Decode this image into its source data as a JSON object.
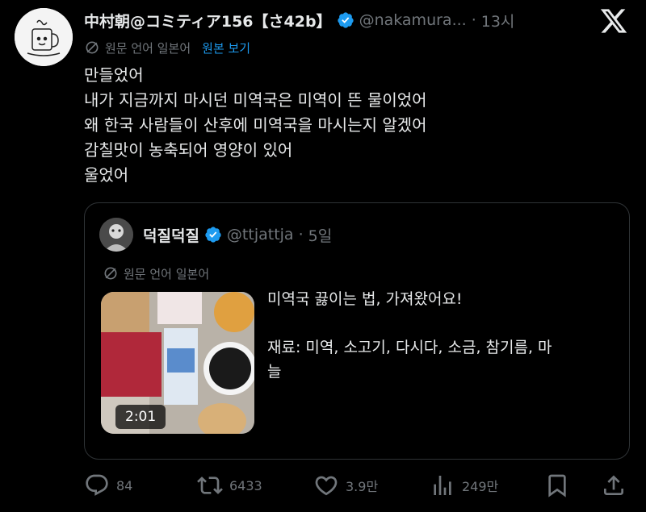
{
  "tweet": {
    "author_name": "中村朝@コミティア156【さ42b】",
    "author_handle": "@nakamura...",
    "time": "13시",
    "translation_note": "원문 언어 일본어",
    "show_original": "원본 보기",
    "text_lines": [
      "만들었어",
      "내가 지금까지 마시던 미역국은 미역이 뜬 물이었어",
      "왜 한국 사람들이 산후에 미역국을 마시는지 알겠어",
      "감칠맛이 농축되어 영양이 있어",
      "울었어"
    ]
  },
  "quote": {
    "author_name": "덕질덕질",
    "author_handle": "@ttjattja",
    "time": "5일",
    "translation_note": "원문 언어 일본어",
    "video_duration": "2:01",
    "text_lines": [
      "미역국 끓이는 법, 가져왔어요!",
      "",
      "재료: 미역, 소고기, 다시다, 소금, 참기름, 마",
      "늘"
    ]
  },
  "actions": {
    "replies": "84",
    "retweets": "6433",
    "likes": "3.9만",
    "views": "249만"
  },
  "colors": {
    "background": "#000000",
    "text": "#e7e9ea",
    "secondary": "#71767b",
    "accent": "#1d9bf0",
    "border": "#2f3336"
  },
  "icons": [
    "x-logo-icon",
    "verified-badge-icon",
    "translate-icon",
    "reply-icon",
    "retweet-icon",
    "like-icon",
    "views-icon",
    "bookmark-icon",
    "share-icon"
  ]
}
